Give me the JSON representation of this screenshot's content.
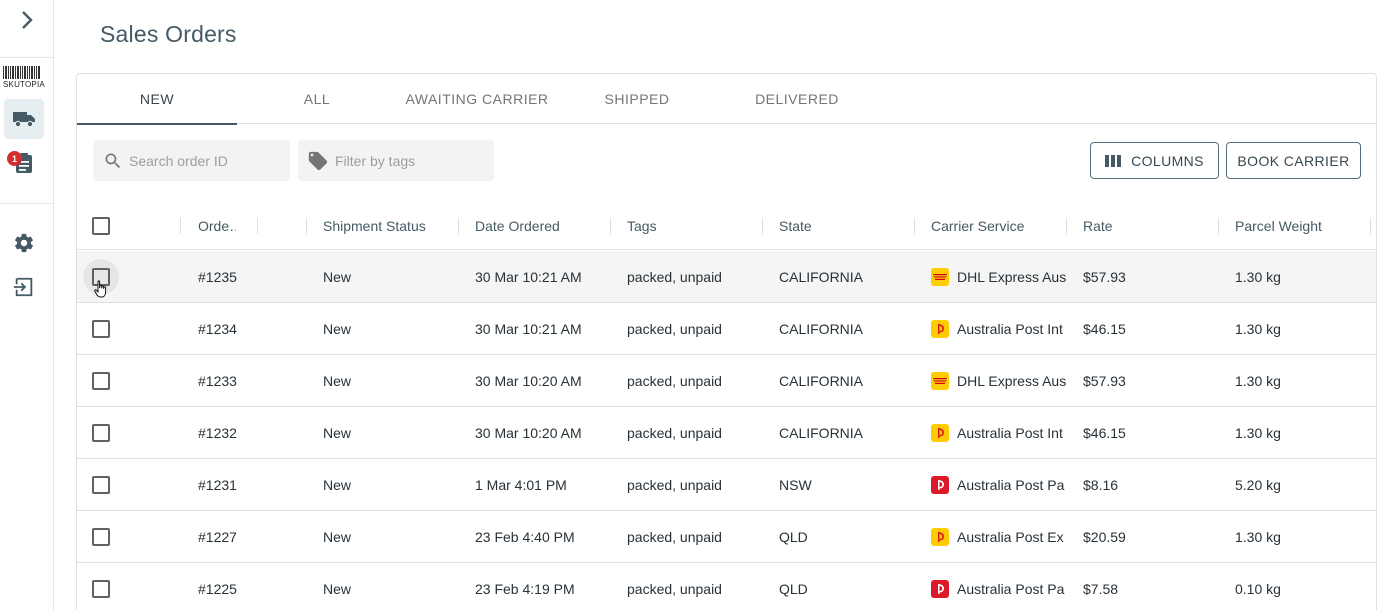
{
  "app": {
    "logo_text": "SKUTOPIA",
    "notification_count": "1"
  },
  "page": {
    "title": "Sales Orders"
  },
  "tabs": [
    {
      "label": "NEW",
      "active": true
    },
    {
      "label": "ALL",
      "active": false
    },
    {
      "label": "AWAITING CARRIER",
      "active": false
    },
    {
      "label": "SHIPPED",
      "active": false
    },
    {
      "label": "DELIVERED",
      "active": false
    }
  ],
  "toolbar": {
    "search_placeholder": "Search order ID",
    "tags_placeholder": "Filter by tags",
    "columns_label": "COLUMNS",
    "book_label": "BOOK CARRIER"
  },
  "table": {
    "headers": {
      "order": "Orde…",
      "status": "Shipment Status",
      "date": "Date Ordered",
      "tags": "Tags",
      "state": "State",
      "carrier": "Carrier Service",
      "rate": "Rate",
      "weight": "Parcel Weight"
    },
    "rows": [
      {
        "order": "#1235",
        "status": "New",
        "date": "30 Mar 10:21 AM",
        "tags": "packed, unpaid",
        "state": "CALIFORNIA",
        "carrier": "DHL Express Aus",
        "carrier_type": "dhl",
        "rate": "$57.93",
        "weight": "1.30 kg"
      },
      {
        "order": "#1234",
        "status": "New",
        "date": "30 Mar 10:21 AM",
        "tags": "packed, unpaid",
        "state": "CALIFORNIA",
        "carrier": "Australia Post Int",
        "carrier_type": "auspost-yellow",
        "rate": "$46.15",
        "weight": "1.30 kg"
      },
      {
        "order": "#1233",
        "status": "New",
        "date": "30 Mar 10:20 AM",
        "tags": "packed, unpaid",
        "state": "CALIFORNIA",
        "carrier": "DHL Express Aus",
        "carrier_type": "dhl",
        "rate": "$57.93",
        "weight": "1.30 kg"
      },
      {
        "order": "#1232",
        "status": "New",
        "date": "30 Mar 10:20 AM",
        "tags": "packed, unpaid",
        "state": "CALIFORNIA",
        "carrier": "Australia Post Int",
        "carrier_type": "auspost-yellow",
        "rate": "$46.15",
        "weight": "1.30 kg"
      },
      {
        "order": "#1231",
        "status": "New",
        "date": "1 Mar 4:01 PM",
        "tags": "packed, unpaid",
        "state": "NSW",
        "carrier": "Australia Post Pa",
        "carrier_type": "auspost-red",
        "rate": "$8.16",
        "weight": "5.20 kg"
      },
      {
        "order": "#1227",
        "status": "New",
        "date": "23 Feb 4:40 PM",
        "tags": "packed, unpaid",
        "state": "QLD",
        "carrier": "Australia Post Ex",
        "carrier_type": "auspost-yellow",
        "rate": "$20.59",
        "weight": "1.30 kg"
      },
      {
        "order": "#1225",
        "status": "New",
        "date": "23 Feb 4:19 PM",
        "tags": "packed, unpaid",
        "state": "QLD",
        "carrier": "Australia Post Pa",
        "carrier_type": "auspost-red",
        "rate": "$7.58",
        "weight": "0.10 kg"
      }
    ]
  },
  "colors": {
    "dhl": "#ffcc00",
    "dhl_text": "#d40511",
    "auspost_yellow": "#ffcc00",
    "auspost_red": "#dc1928",
    "accent": "#455a64"
  },
  "icons": {
    "expand": "chevron-right-icon",
    "shipping": "truck-icon",
    "orders": "clipboard-icon",
    "settings": "gear-icon",
    "logout": "logout-icon",
    "search": "search-icon",
    "tag": "tag-icon",
    "columns": "columns-icon"
  }
}
